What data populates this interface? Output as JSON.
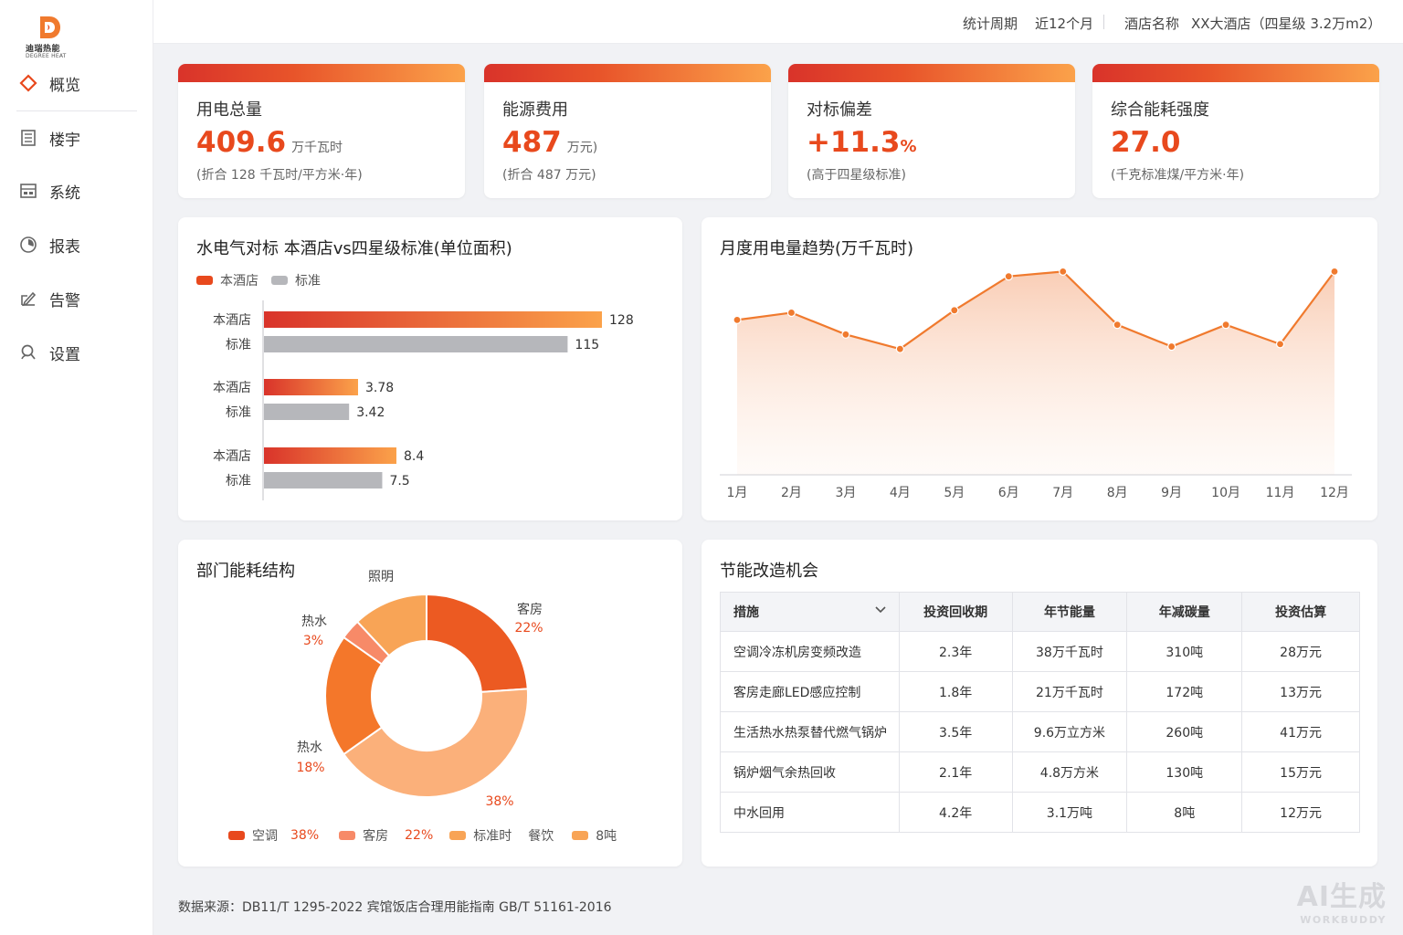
{
  "brand": {
    "name_cn": "迪瑞热能",
    "name_en": "DEGREE HEAT",
    "color": "#e8491d"
  },
  "nav": [
    {
      "label": "概览",
      "icon": "diamond-icon"
    },
    {
      "label": "楼宇",
      "icon": "building-icon"
    },
    {
      "label": "系统",
      "icon": "system-icon"
    },
    {
      "label": "报表",
      "icon": "report-icon"
    },
    {
      "label": "告警",
      "icon": "alert-icon"
    },
    {
      "label": "设置",
      "icon": "settings-icon"
    }
  ],
  "topbar": {
    "period_label": "统计周期",
    "period_value": "近12个月",
    "hotel_label": "酒店名称",
    "hotel_value": "XX大酒店（四星级 3.2万m2）"
  },
  "kpis": [
    {
      "title": "用电总量",
      "value": "409.6",
      "unit": "万千瓦时",
      "note": "(折合 128 千瓦时/平方米·年)"
    },
    {
      "title": "能源费用",
      "value": "487",
      "unit": "万元)",
      "note": "(折合 487 万元)"
    },
    {
      "title": "对标偏差",
      "value": "+11.3",
      "unit": "%",
      "note": "(高于四星级标准)"
    },
    {
      "title": "综合能耗强度",
      "value": "27.0",
      "unit": "",
      "note": "(千克标准煤/平方米·年)"
    }
  ],
  "benchmark": {
    "title": "水电气对标 本酒店vs四星级标准(单位面积)",
    "legend": [
      "本酒店",
      "标准"
    ]
  },
  "trend": {
    "title": "月度用电量趋势(万千瓦时)"
  },
  "structure": {
    "title": "部门能耗结构",
    "slice_labels": [
      {
        "name": "客房",
        "pct": "22%"
      },
      {
        "name": "",
        "pct": "38%"
      },
      {
        "name": "热水",
        "pct": "18%"
      },
      {
        "name": "热水",
        "pct": "3%"
      },
      {
        "name": "照明",
        "pct": ""
      }
    ],
    "legend": [
      {
        "name": "空调",
        "pct": "38%"
      },
      {
        "name": "客房",
        "pct": "22%"
      },
      {
        "name": "标准时",
        "pct": ""
      },
      {
        "name": "餐饮",
        "pct": ""
      },
      {
        "name": "8吨",
        "pct": ""
      }
    ]
  },
  "opportunities": {
    "title": "节能改造机会",
    "columns": [
      "措施",
      "投资回收期",
      "年节能量",
      "年减碳量",
      "投资估算"
    ],
    "rows": [
      [
        "空调冷冻机房变频改造",
        "2.3年",
        "38万千瓦时",
        "310吨",
        "28万元"
      ],
      [
        "客房走廊LED感应控制",
        "1.8年",
        "21万千瓦时",
        "172吨",
        "13万元"
      ],
      [
        "生活热水热泵替代燃气锅炉",
        "3.5年",
        "9.6万立方米",
        "260吨",
        "41万元"
      ],
      [
        "锅炉烟气余热回收",
        "2.1年",
        "4.8万方米",
        "130吨",
        "15万元"
      ],
      [
        "中水回用",
        "4.2年",
        "3.1万吨",
        "8吨",
        "12万元"
      ]
    ]
  },
  "footer": "数据来源：DB11/T 1295-2022 宾馆饭店合理用能指南   GB/T 51161-2016",
  "watermark": {
    "main": "AI生成",
    "sub": "WORKBUDDY"
  },
  "chart_data": [
    {
      "type": "bar",
      "orientation": "horizontal",
      "title": "水电气对标 本酒店vs四星级标准(单位面积)",
      "categories": [
        "本酒店",
        "本酒店",
        "本酒店"
      ],
      "series": [
        {
          "name": "本酒店",
          "values": [
            128,
            3.78,
            8.4
          ],
          "labels": [
            "128",
            "3.78",
            "8.4"
          ]
        },
        {
          "name": "标准",
          "values": [
            115,
            3.42,
            7.5
          ],
          "labels": [
            "115",
            "3.42",
            "7.5"
          ]
        }
      ],
      "group_row_labels": [
        "本酒店",
        "标准"
      ],
      "legend": "top-left",
      "colors": {
        "本酒店": "#e8491d",
        "标准": "#b6b7bb"
      }
    },
    {
      "type": "area",
      "title": "月度用电量趋势(万千瓦时)",
      "categories": [
        "1月",
        "2月",
        "3月",
        "4月",
        "5月",
        "6月",
        "7月",
        "8月",
        "9月",
        "10月",
        "11月",
        "12月"
      ],
      "values": [
        32,
        33.5,
        29,
        26,
        34,
        41,
        42,
        31,
        26.5,
        31,
        27,
        42
      ],
      "ylim": [
        0,
        50
      ],
      "grid": false,
      "color": "#f07a2e"
    },
    {
      "type": "pie",
      "donut": true,
      "title": "部门能耗结构",
      "slices": [
        {
          "label": "客房",
          "value": 22,
          "color": "#ec5a22"
        },
        {
          "label": "",
          "value": 38,
          "color": "#fbb07a"
        },
        {
          "label": "热水",
          "value": 18,
          "color": "#f4772a"
        },
        {
          "label": "热水",
          "value": 3,
          "color": "#f78a68"
        },
        {
          "label": "照明",
          "value": 11,
          "color": "#f8a456"
        }
      ]
    }
  ]
}
